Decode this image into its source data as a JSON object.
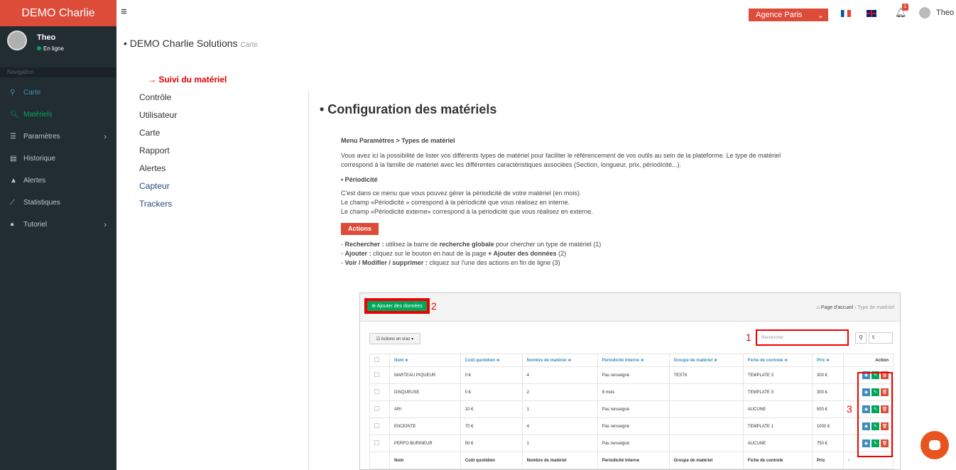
{
  "app": {
    "brand": "DEMO Charlie",
    "user": "Theo",
    "status": "En ligne",
    "agency": "Agence Paris",
    "notif_count": "1"
  },
  "nav": {
    "header": "Navigation",
    "items": [
      {
        "label": "Carte",
        "icon": "map-marker-icon"
      },
      {
        "label": "Matériels",
        "icon": "search-icon"
      },
      {
        "label": "Paramètres",
        "icon": "list-icon"
      },
      {
        "label": "Historique",
        "icon": "calendar-icon"
      },
      {
        "label": "Alertes",
        "icon": "warning-icon"
      },
      {
        "label": "Statistiques",
        "icon": "chart-icon"
      },
      {
        "label": "Tutoriel",
        "icon": "info-icon"
      }
    ]
  },
  "page": {
    "title": "• DEMO Charlie Solutions",
    "subtitle": "Carte"
  },
  "docmenu": {
    "active": "Suivi du matériel",
    "items": [
      "Contrôle",
      "Utilisateur",
      "Carte",
      "Rapport",
      "Alertes",
      "Capteur",
      "Trackers"
    ]
  },
  "doc": {
    "title": "• Configuration des matériels",
    "crumb": "Menu Paramètres > Types de matériel",
    "intro": "Vous avez ici la possibilité de lister vos différents types de matériel pour faciliter le référencement de vos outils au sein de la plateforme. Le type de matériel correspond à la famille de matériel avec les différentes caractéristiques associées (Section, longueur, prix, périodicité...).",
    "sub": "• Périodicité",
    "p1": "C'est dans ce menu que vous pouvez gérer la périodicité de votre matériel (en mois).",
    "p2": "Le champ «Périodicité » correspond à la périodicité que vous réalisez en interne.",
    "p3": "Le champ «Périodicité externe» correspond à la périodicité que vous réalisez en externe.",
    "actions": "Actions",
    "a1_b": "Rechercher :",
    "a1_t": " utilisez la barre de ",
    "a1_b2": "recherche globale",
    "a1_t2": " pour chercher un type de matériel (1)",
    "a2_b": "Ajouter :",
    "a2_t": " cliquez sur le bouton en haut de la page ",
    "a2_b2": "+ Ajouter des données",
    "a2_t2": " (2)",
    "a3_b": "Voir / Modifier / supprimer :",
    "a3_t": " cliquez sur l'une des actions en fin de ligne (3)"
  },
  "shot": {
    "add_btn": "⊕ Ajouter des données",
    "label1": "1",
    "label2": "2",
    "label3": "3",
    "home": "Page d'accueil",
    "crumb": "Type de matériel",
    "bulk": "☑ Actions en vrac ▾",
    "search_placeholder": "Rechercher",
    "page_size": "5",
    "headers": [
      "Nom ≑",
      "Coût quotidien ≑",
      "Nombre de matériel ≑",
      "Periodicité Interne ≑",
      "Groupe de matériel ≑",
      "Fiche de controle ≑",
      "Prix ≑",
      "Action"
    ],
    "rows": [
      [
        "MARTEAU PIQUEUR",
        "0 €",
        "4",
        "Pas renseigné",
        "TEST6",
        "TEMPLATE 3",
        "300 €"
      ],
      [
        "DISQUEUSE",
        "0 €",
        "2",
        "6 mois",
        "",
        "TEMPLATE 3",
        "300 €"
      ],
      [
        "ARI",
        "10 €",
        "1",
        "Pas renseigné",
        "",
        "AUCUNE",
        "500 €"
      ],
      [
        "ENCEINTE",
        "70 €",
        "4",
        "Pas renseigné",
        "",
        "TEMPLATE 1",
        "1000 €"
      ],
      [
        "PERFO BURINEUR",
        "50 €",
        "1",
        "Pas renseigné",
        "",
        "AUCUNE",
        "750 €"
      ]
    ],
    "footer": [
      "Nom",
      "Coût quotidien",
      "Nombre de matériel",
      "Periodicité Interne",
      "Groupe de matériel",
      "Fiche de controle",
      "Prix",
      "-"
    ]
  }
}
